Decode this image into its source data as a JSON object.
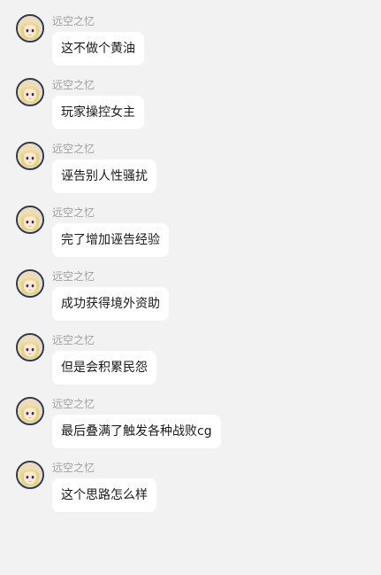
{
  "messages": [
    {
      "sender": "远空之忆",
      "text": "这不做个黄油"
    },
    {
      "sender": "远空之忆",
      "text": "玩家操控女主"
    },
    {
      "sender": "远空之忆",
      "text": "诬告别人性骚扰"
    },
    {
      "sender": "远空之忆",
      "text": "完了增加诬告经验"
    },
    {
      "sender": "远空之忆",
      "text": "成功获得境外资助"
    },
    {
      "sender": "远空之忆",
      "text": "但是会积累民怨"
    },
    {
      "sender": "远空之忆",
      "text": "最后叠满了触发各种战败cg"
    },
    {
      "sender": "远空之忆",
      "text": "这个思路怎么样"
    }
  ],
  "icons": {
    "avatar": "anime-avatar-icon"
  },
  "colors": {
    "background": "#f2f2f2",
    "bubble": "#ffffff",
    "sender_name": "#a0a0a0",
    "message_text": "#1a1a1a"
  }
}
